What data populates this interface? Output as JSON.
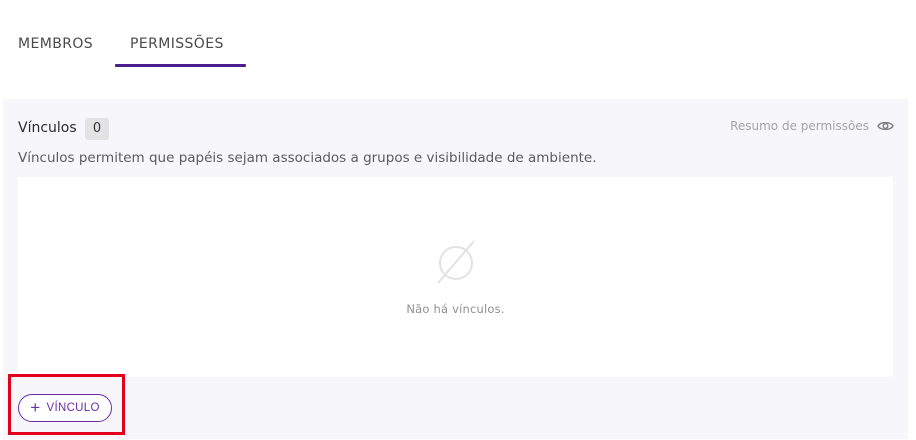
{
  "tabs": [
    {
      "label": "MEMBROS"
    },
    {
      "label": "PERMISSÕES"
    }
  ],
  "active_tab": "PERMISSÕES",
  "vinculos": {
    "title": "Vínculos",
    "count": "0",
    "summary_label": "Resumo de permissões",
    "description": "Vínculos permitem que papéis sejam associados a grupos e visibilidade de ambiente.",
    "empty_message": "Não há vínculos.",
    "add_button_label": "VÍNCULO"
  },
  "icons": {
    "summary": "eye-icon",
    "empty": "empty-set-icon",
    "add": "plus-icon"
  },
  "colors": {
    "accent": "#6a2fa8",
    "tab_underline": "#4b1d8f",
    "highlight": "#e3001b",
    "panel_background": "#f7f6fb"
  }
}
